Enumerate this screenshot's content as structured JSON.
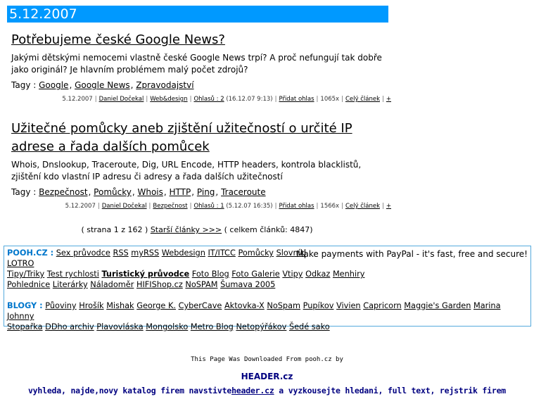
{
  "date": "5.12.2007",
  "articles": [
    {
      "title": "Potřebujeme české Google News?",
      "body": "Jakými dětskými nemocemi vlastně české Google News trpí? A proč nefungují tak dobře jako originál? Je hlavním problémem malý počet zdrojů?",
      "tags_label": "Tagy :",
      "tags": [
        "Google",
        "Google News",
        "Zpravodajství"
      ],
      "meta": {
        "date": "5.12.2007",
        "author": "Daniel Dočekal",
        "category": "Web&design",
        "comments": "Ohlasů : 2",
        "comments_date": "(16.12.07 9:13)",
        "add": "Přidat ohlas",
        "views": "1065x",
        "full": "Celý článek",
        "plus": "+"
      }
    },
    {
      "title": "Užitečné pomůcky aneb zjištění užitečností o určité IP adrese a řada dalších pomůcek",
      "body": "Whois, Dnslookup, Traceroute, Dig, URL Encode, HTTP headers, kontrola blacklistů, zjištění kdo vlastní IP adresu či adresy a řada dalších užitečností",
      "tags_label": "Tagy :",
      "tags": [
        "Bezpečnost",
        "Pomůcky",
        "Whois",
        "HTTP",
        "Ping",
        "Traceroute"
      ],
      "meta": {
        "date": "5.12.2007",
        "author": "Daniel Dočekal",
        "category": "Bezpečnost",
        "comments": "Ohlasů : 1",
        "comments_date": "(5.12.07 16:35)",
        "add": "Přidat ohlas",
        "views": "1566x",
        "full": "Celý článek",
        "plus": "+"
      }
    }
  ],
  "pager": {
    "prefix": "( strana 1 z 162 )",
    "link": "Starší články >>>",
    "suffix": "( celkem článků: 4847)"
  },
  "box": {
    "pooh_label": "POOH.CZ :",
    "pooh_links": [
      "Sex průvodce",
      "RSS",
      "myRSS",
      "Webdesign",
      "IT/ITCC",
      "Pomůcky",
      "Slovník"
    ],
    "paypal": "Make payments with PayPal - it's fast, free and secure!",
    "pooh_links2": [
      "LOTRO"
    ],
    "pooh_links3": [
      "Tipy/Triky",
      "Test rychlosti",
      "Turistický průvodce",
      "Foto Blog",
      "Foto Galerie",
      "Vtipy",
      "Odkaz",
      "Menhiry"
    ],
    "pooh_links4": [
      "Pohlednice",
      "Literárky",
      "Náladoměr",
      "HIFIShop.cz",
      "NoSPAM",
      "Šumava 2005"
    ],
    "blogy_label": "BLOGY :",
    "blogy_links": [
      "Půoviny",
      "Hrošík",
      "Mishak",
      "George K.",
      "CyberCave",
      "Aktovka-X",
      "NoSpam",
      "Pupíkov",
      "Vivien",
      "Capricorn",
      "Maggie's Garden",
      "Marina",
      "Johnny"
    ],
    "blogy_links2": [
      "Stopařka",
      "DDho archiv",
      "Plavovláska",
      "Mongolsko",
      "Metro Blog",
      "Netopýřákov",
      "Šedé sako"
    ]
  },
  "footer": {
    "line1": "This Page Was Downloaded From pooh.cz by",
    "line2": "HEADER.cz",
    "line3_prefix": "vyhleda, najde,novy katalog firem navstivte",
    "line3_link": "header.cz",
    "line3_suffix": " a vyzkousejte hledani, full text, rejstrik firem"
  }
}
